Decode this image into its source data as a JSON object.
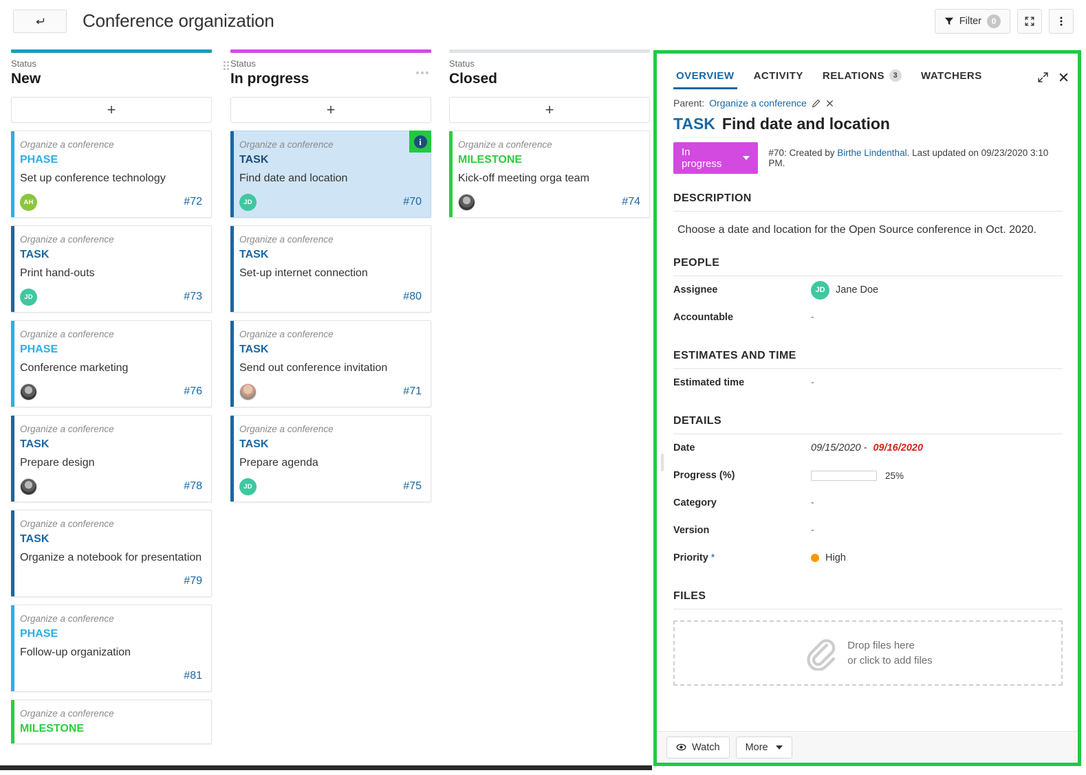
{
  "topbar": {
    "back_label": "back-arrow",
    "title": "Conference organization",
    "filter_label": "Filter",
    "filter_count": "0",
    "fullscreen_label": "fullscreen-icon",
    "more_label": "more-icon"
  },
  "board": {
    "status_word": "Status",
    "add_label": "+",
    "columns": [
      {
        "status_label": "Status",
        "name": "New",
        "accent": "#1a9eb5",
        "cards": [
          {
            "project": "Organize a conference",
            "type": "PHASE",
            "type_color": "#2daee8",
            "bar": "#2daee8",
            "subject": "Set up conference technology",
            "id": "#72",
            "avatar": {
              "kind": "initials",
              "text": "AH",
              "color": "#8cc63f"
            },
            "selected": false,
            "info_badge": false
          },
          {
            "project": "Organize a conference",
            "type": "TASK",
            "type_color": "#1a67a3",
            "bar": "#1a67a3",
            "subject": "Print hand-outs",
            "id": "#73",
            "avatar": {
              "kind": "initials",
              "text": "JD",
              "color": "#3ec8a0"
            },
            "selected": false,
            "info_badge": false
          },
          {
            "project": "Organize a conference",
            "type": "PHASE",
            "type_color": "#2daee8",
            "bar": "#2daee8",
            "subject": "Conference marketing",
            "id": "#76",
            "avatar": {
              "kind": "photo",
              "text": "",
              "color": ""
            },
            "selected": false,
            "info_badge": false
          },
          {
            "project": "Organize a conference",
            "type": "TASK",
            "type_color": "#1a67a3",
            "bar": "#1a67a3",
            "subject": "Prepare design",
            "id": "#78",
            "avatar": {
              "kind": "photo",
              "text": "",
              "color": ""
            },
            "selected": false,
            "info_badge": false
          },
          {
            "project": "Organize a conference",
            "type": "TASK",
            "type_color": "#1a67a3",
            "bar": "#1a67a3",
            "subject": "Organize a notebook for presentation",
            "id": "#79",
            "avatar": null,
            "selected": false,
            "info_badge": false
          },
          {
            "project": "Organize a conference",
            "type": "PHASE",
            "type_color": "#2daee8",
            "bar": "#2daee8",
            "subject": "Follow-up organization",
            "id": "#81",
            "avatar": null,
            "selected": false,
            "info_badge": false
          },
          {
            "project": "Organize a conference",
            "type": "MILESTONE",
            "type_color": "#2ecc40",
            "bar": "#2ecc40",
            "subject": "",
            "id": "",
            "avatar": null,
            "selected": false,
            "info_badge": false
          }
        ]
      },
      {
        "status_label": "Status",
        "name": "In progress",
        "accent": "#cc4ee0",
        "cards": [
          {
            "project": "Organize a conference",
            "type": "TASK",
            "type_color": "#1a4f7a",
            "bar": "#1a67a3",
            "subject": "Find date and location",
            "id": "#70",
            "avatar": {
              "kind": "initials",
              "text": "JD",
              "color": "#3ec8a0"
            },
            "selected": true,
            "info_badge": true
          },
          {
            "project": "Organize a conference",
            "type": "TASK",
            "type_color": "#1a67a3",
            "bar": "#1a67a3",
            "subject": "Set-up internet connection",
            "id": "#80",
            "avatar": null,
            "selected": false,
            "info_badge": false
          },
          {
            "project": "Organize a conference",
            "type": "TASK",
            "type_color": "#1a67a3",
            "bar": "#1a67a3",
            "subject": "Send out conference invitation",
            "id": "#71",
            "avatar": {
              "kind": "photo2",
              "text": "",
              "color": ""
            },
            "selected": false,
            "info_badge": false
          },
          {
            "project": "Organize a conference",
            "type": "TASK",
            "type_color": "#1a67a3",
            "bar": "#1a67a3",
            "subject": "Prepare agenda",
            "id": "#75",
            "avatar": {
              "kind": "initials",
              "text": "JD",
              "color": "#3ec8a0"
            },
            "selected": false,
            "info_badge": false
          }
        ]
      },
      {
        "status_label": "Status",
        "name": "Closed",
        "accent": "#dfe3e6",
        "cards": [
          {
            "project": "Organize a conference",
            "type": "MILESTONE",
            "type_color": "#2ecc40",
            "bar": "#2ecc40",
            "subject": "Kick-off meeting orga team",
            "id": "#74",
            "avatar": {
              "kind": "photo",
              "text": "",
              "color": ""
            },
            "selected": false,
            "info_badge": false
          }
        ]
      }
    ]
  },
  "detail": {
    "border_color": "#22c942",
    "tabs": [
      {
        "label": "OVERVIEW",
        "count": "",
        "active": true
      },
      {
        "label": "ACTIVITY",
        "count": "",
        "active": false
      },
      {
        "label": "RELATIONS",
        "count": "3",
        "active": false
      },
      {
        "label": "WATCHERS",
        "count": "",
        "active": false
      }
    ],
    "parent": {
      "prefix": "Parent:",
      "name": "Organize a conference"
    },
    "wp": {
      "type": "TASK",
      "subject": "Find date and location"
    },
    "status": {
      "label": "In progress",
      "color": "#d34ae0"
    },
    "meta": {
      "id_prefix": "#70: Created by",
      "author": "Birthe Lindenthal",
      "suffix": ". Last updated on 09/23/2020 3:10 PM."
    },
    "sections": {
      "description": {
        "title": "DESCRIPTION",
        "text": "Choose a date and location for the Open Source conference in Oct. 2020."
      },
      "people": {
        "title": "PEOPLE",
        "rows": [
          {
            "label": "Assignee",
            "value": "Jane Doe",
            "avatar": "JD",
            "avatar_color": "#3ec8a0"
          },
          {
            "label": "Accountable",
            "value": "-",
            "avatar": "",
            "avatar_color": ""
          }
        ]
      },
      "estimates": {
        "title": "ESTIMATES AND TIME",
        "rows": [
          {
            "label": "Estimated time",
            "value": "-"
          }
        ]
      },
      "details": {
        "title": "DETAILS",
        "date_label": "Date",
        "date_start": "09/15/2020 - ",
        "date_end": "09/16/2020",
        "progress_label": "Progress (%)",
        "progress_value": "25%",
        "progress_pct": 25,
        "category_label": "Category",
        "category_value": "-",
        "version_label": "Version",
        "version_value": "-",
        "priority_label": "Priority ",
        "priority_required": "*",
        "priority_value": "High",
        "priority_color": "#ff9800"
      },
      "files": {
        "title": "FILES",
        "drop_line1": "Drop files here",
        "drop_line2": "or click to add files"
      }
    },
    "footer": {
      "watch_label": "Watch",
      "more_label": "More"
    }
  }
}
